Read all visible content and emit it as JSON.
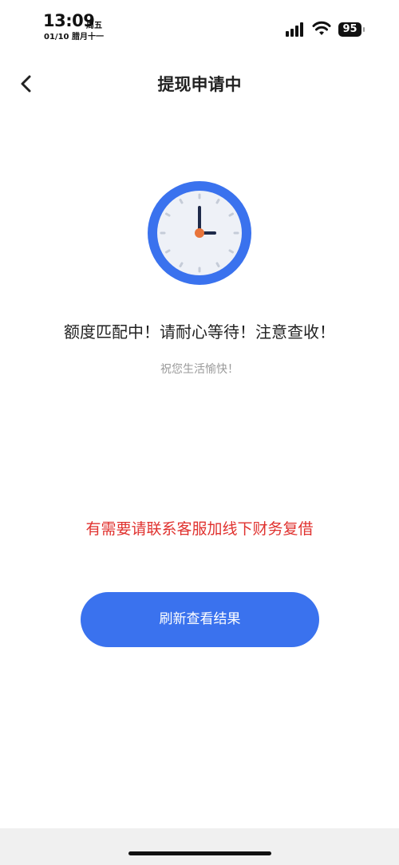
{
  "status_bar": {
    "time": "13:09",
    "weekday": "周五",
    "date": "01/10 腊月十一",
    "battery": "95",
    "signal_icon": "signal-icon",
    "wifi_icon": "wifi-icon"
  },
  "nav": {
    "title": "提现申请中",
    "back_icon": "chevron-left-icon"
  },
  "content": {
    "main_message": "额度匹配中！请耐心等待！注意查收！",
    "sub_message": "祝您生活愉快！",
    "notice": "有需要请联系客服加线下财务复借",
    "refresh_button": "刷新查看结果"
  },
  "colors": {
    "accent": "#3a72ee",
    "notice_red": "#e0322f",
    "clock_ring": "#3a72ee",
    "clock_face": "#eef1f7",
    "clock_center": "#e8743b"
  }
}
